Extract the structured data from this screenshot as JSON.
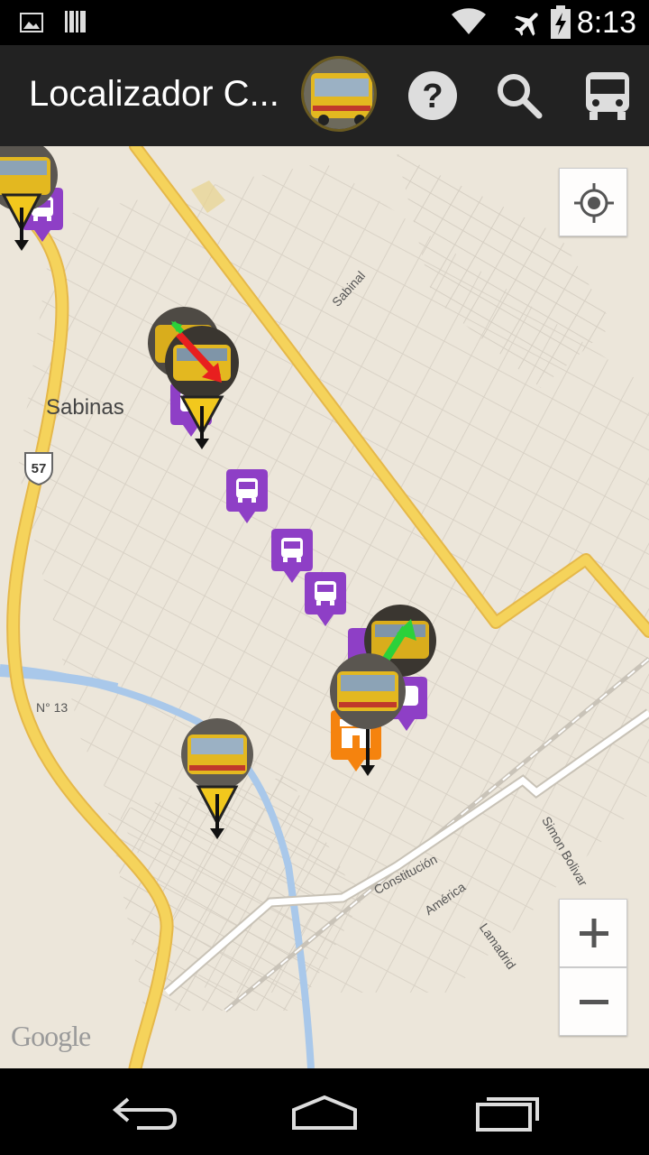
{
  "status_bar": {
    "time": "8:13",
    "icons": [
      "image-icon",
      "barcode-icon",
      "wifi-icon",
      "airplane-icon",
      "battery-charging-icon"
    ]
  },
  "action_bar": {
    "title": "Localizador C...",
    "actions": [
      "help-icon",
      "search-icon",
      "bus-icon"
    ]
  },
  "map": {
    "city_label": "Sabinas",
    "route_shield": "57",
    "street_labels": {
      "sabinal": "Sabinal",
      "n13": "N° 13",
      "constitucion": "Constitución",
      "america": "América",
      "simon_bolivar": "Simon Bolivar",
      "lamadrid": "Lamadrid"
    },
    "attribution": "Google",
    "colors": {
      "land": "#ece6da",
      "highway": "#f5d35b",
      "river": "#a9c8ea",
      "stop_marker": "#8e3fc6",
      "store_marker": "#f5830e",
      "direction_green": "#2bd13a",
      "direction_red": "#e81f1f"
    }
  },
  "map_controls": {
    "locate": "my-location-icon",
    "zoom_in": "+",
    "zoom_out": "−"
  },
  "nav_bar": {
    "buttons": [
      "back-icon",
      "home-icon",
      "recents-icon"
    ]
  }
}
